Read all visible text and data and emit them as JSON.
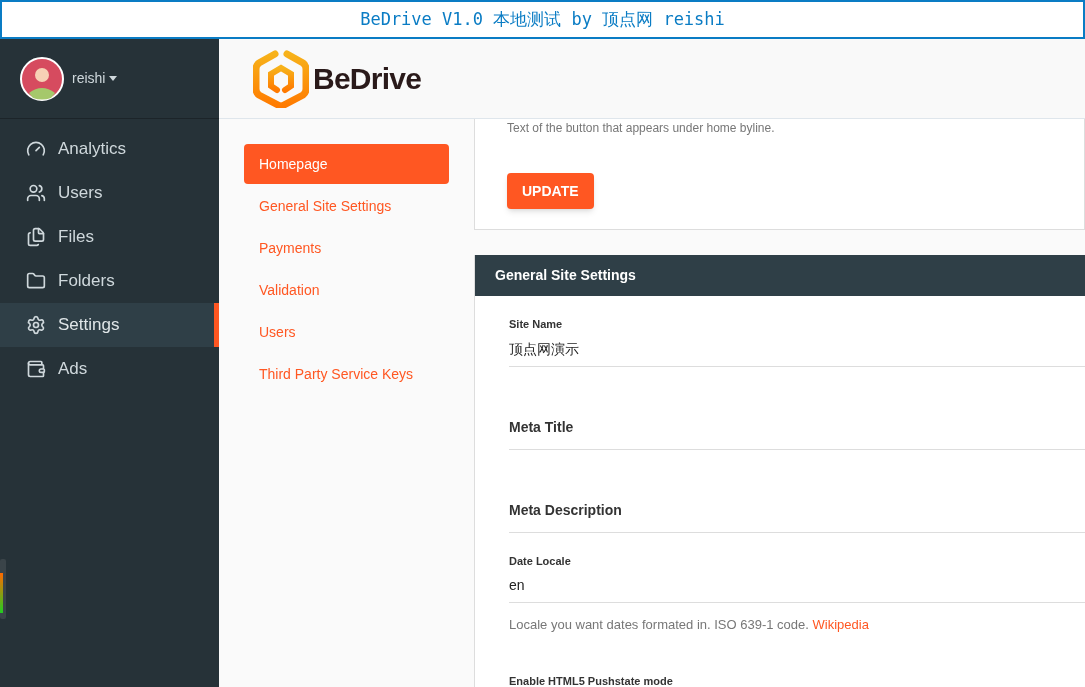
{
  "caption": "BeDrive V1.0 本地测试 by 顶点网 reishi",
  "user": {
    "name": "reishi"
  },
  "logo": {
    "text": "BeDrive"
  },
  "nav": [
    {
      "label": "Analytics",
      "selected": false
    },
    {
      "label": "Users",
      "selected": false
    },
    {
      "label": "Files",
      "selected": false
    },
    {
      "label": "Folders",
      "selected": false
    },
    {
      "label": "Settings",
      "selected": true
    },
    {
      "label": "Ads",
      "selected": false
    }
  ],
  "settings_menu": [
    {
      "label": "Homepage",
      "selected": true
    },
    {
      "label": "General Site Settings",
      "selected": false
    },
    {
      "label": "Payments",
      "selected": false
    },
    {
      "label": "Validation",
      "selected": false
    },
    {
      "label": "Users",
      "selected": false
    },
    {
      "label": "Third Party Service Keys",
      "selected": false
    }
  ],
  "homepage_card": {
    "help": "Text of the button that appears under home byline.",
    "button": "UPDATE"
  },
  "general_card": {
    "title": "General Site Settings",
    "fields": [
      {
        "kind": "text",
        "label": "Site Name",
        "value": "顶点网演示"
      },
      {
        "kind": "heading",
        "label": "Meta Title"
      },
      {
        "kind": "heading",
        "label": "Meta Description"
      },
      {
        "kind": "text",
        "label": "Date Locale",
        "value": "en",
        "help": "Locale you want dates formated in. ISO 639-1 code.",
        "link": "Wikipedia"
      },
      {
        "kind": "toggle_label",
        "label": "Enable HTML5 Pushstate mode"
      }
    ]
  }
}
